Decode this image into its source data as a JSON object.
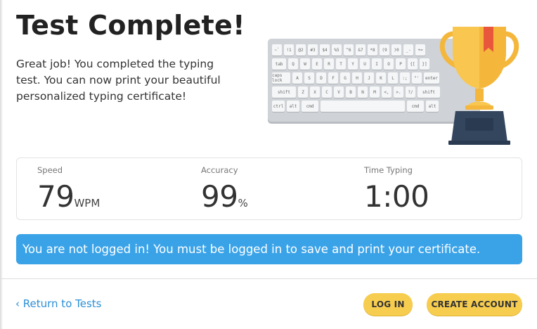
{
  "header": {
    "title": "Test Complete!",
    "message": "Great job! You completed the typing test. You can now print your beautiful personalized typing certificate!"
  },
  "illustration": {
    "keyboard_icon": "keyboard-icon",
    "trophy_icon": "trophy-icon",
    "keyboard_rows": [
      [
        "~`",
        "!1",
        "@2",
        "#3",
        "$4",
        "%5",
        "^6",
        "&7",
        "*8",
        "(9",
        ")0",
        "_-",
        "+="
      ],
      [
        "tab",
        "Q",
        "W",
        "E",
        "R",
        "T",
        "Y",
        "U",
        "I",
        "O",
        "P",
        "{[",
        "}]"
      ],
      [
        "caps lock",
        "A",
        "S",
        "D",
        "F",
        "G",
        "H",
        "J",
        "K",
        "L",
        ":;",
        "\"'",
        "enter"
      ],
      [
        "shift",
        "Z",
        "X",
        "C",
        "V",
        "B",
        "N",
        "M",
        "<,",
        ">.",
        "?/",
        "shift"
      ],
      [
        "ctrl",
        "alt",
        "cmd",
        "",
        "cmd",
        "alt"
      ]
    ]
  },
  "stats": {
    "speed": {
      "label": "Speed",
      "value": "79",
      "unit": "WPM"
    },
    "accuracy": {
      "label": "Accuracy",
      "value": "99",
      "unit": "%"
    },
    "time": {
      "label": "Time Typing",
      "value": "1:00"
    }
  },
  "alert": {
    "text": "You are not logged in! You must be logged in to save and print your certificate."
  },
  "footer": {
    "return_link": "‹ Return to Tests",
    "login_button": "LOG IN",
    "create_account_button": "CREATE ACCOUNT"
  },
  "colors": {
    "alert_bg": "#3aa3e8",
    "button_bg": "#f7cd4f",
    "link": "#2b8fd6",
    "trophy_gold": "#f9c74f",
    "trophy_base": "#34465e"
  }
}
